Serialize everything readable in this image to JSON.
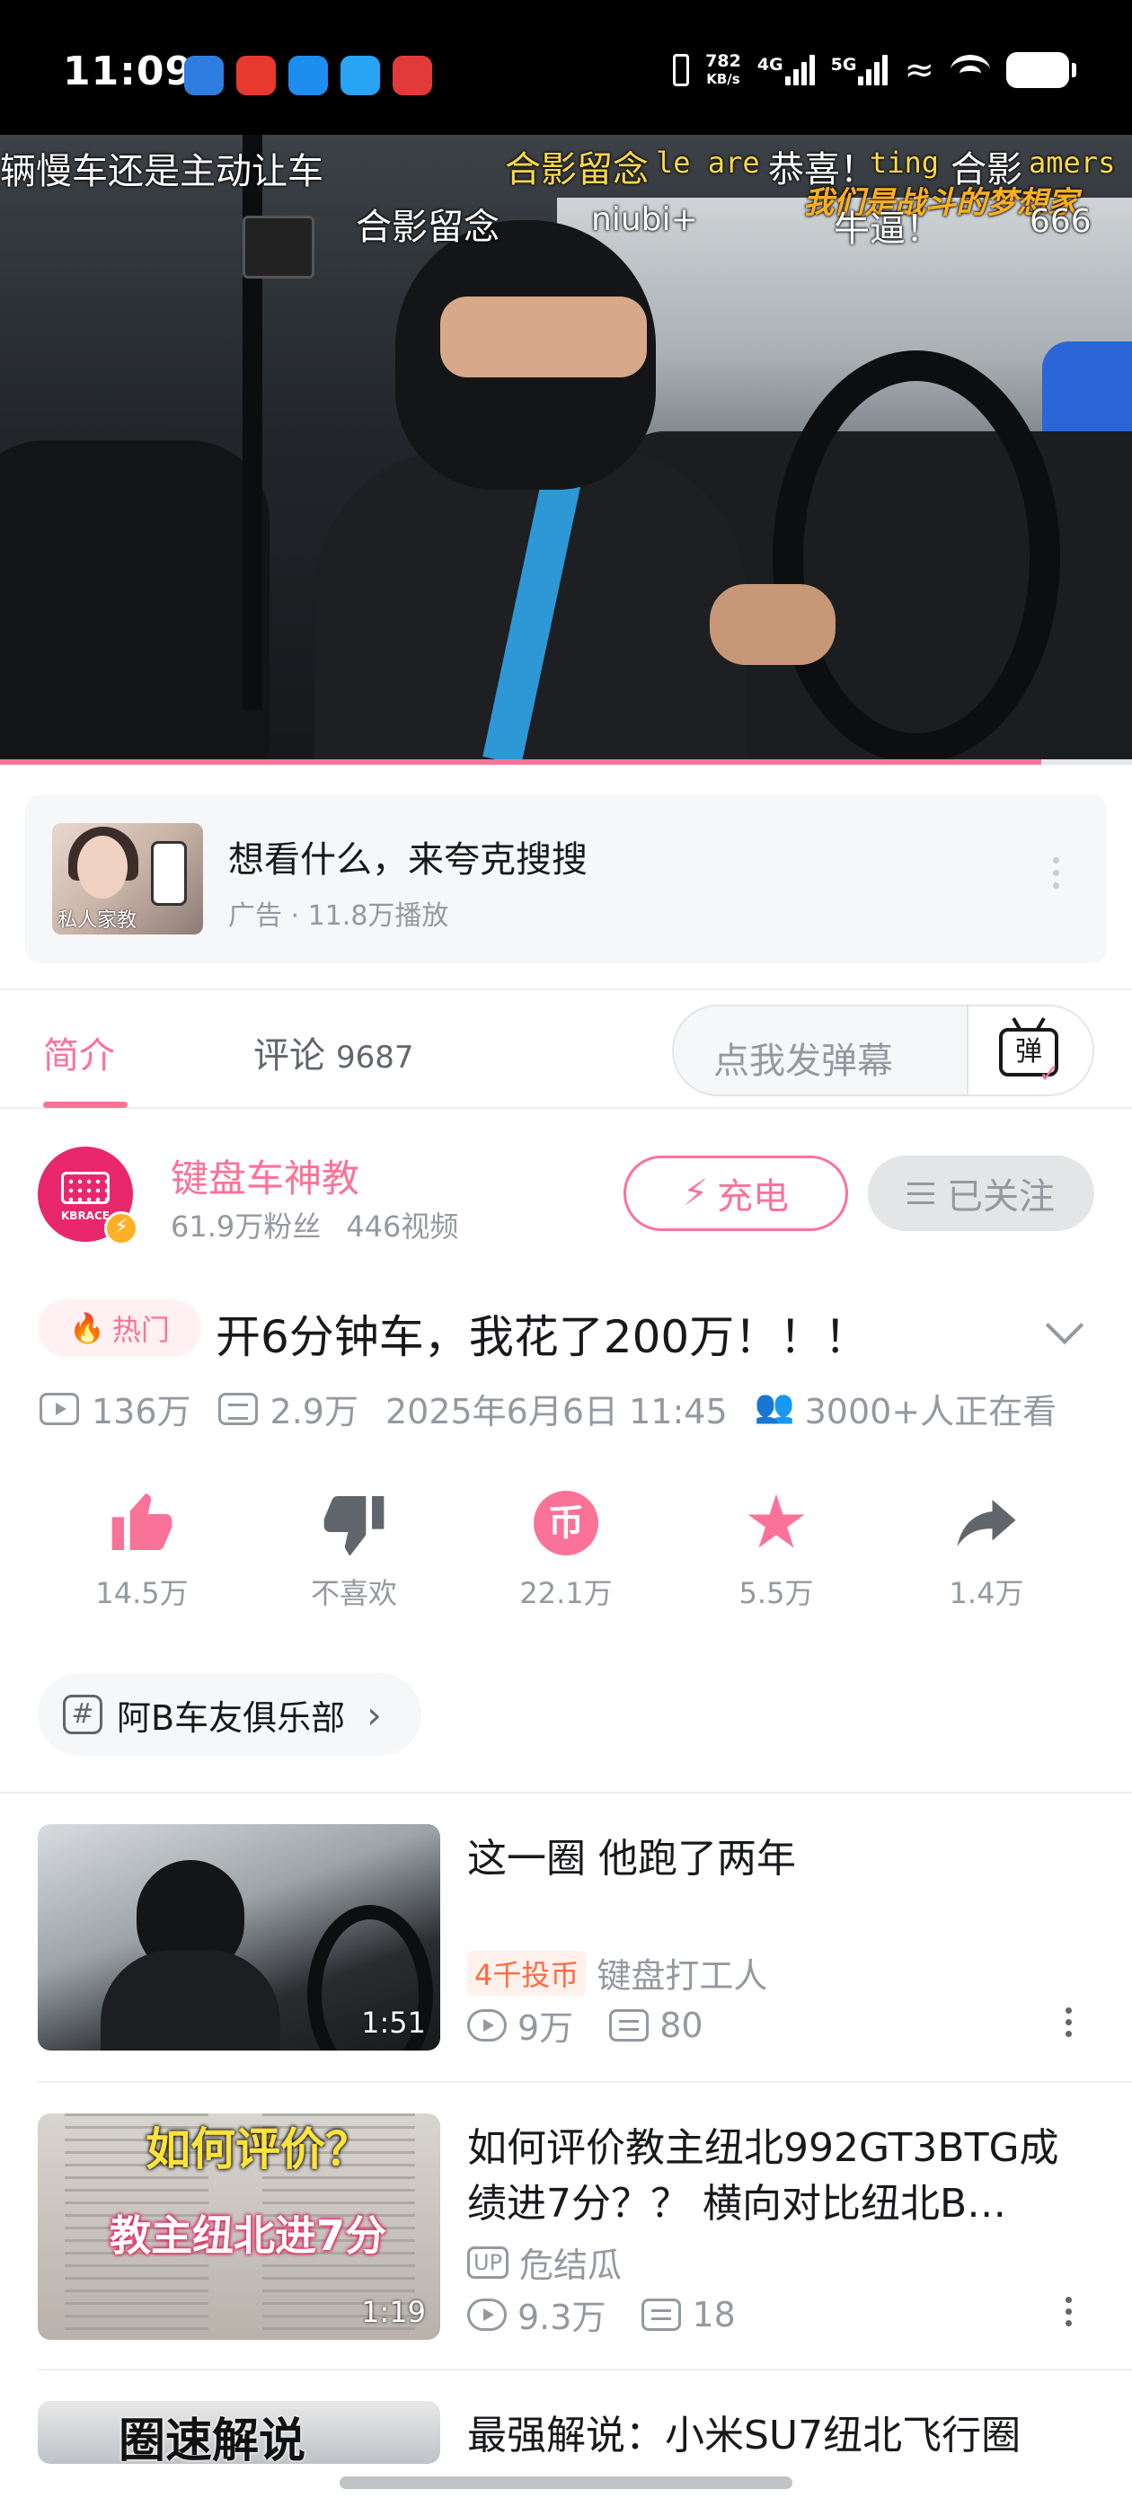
{
  "status_bar": {
    "time": "11:09",
    "net_speed_value": "782",
    "net_speed_unit": "KB/s",
    "net_4g": "4G",
    "net_5g": "5G"
  },
  "player": {
    "progress_fraction": 0.92,
    "danmaku": [
      {
        "text": "辆慢车还是主动让车",
        "color": "#ffffff"
      },
      {
        "text": "合影留念",
        "color": "#ffd84a"
      },
      {
        "text": "le are",
        "color": "#ffd84a"
      },
      {
        "text": "恭喜！",
        "color": "#ffffff"
      },
      {
        "text": "ting",
        "color": "#ffd84a"
      },
      {
        "text": "合影",
        "color": "#ffffff"
      },
      {
        "text": "amers",
        "color": "#ffd84a"
      },
      {
        "text": "合影留念",
        "color": "#ffffff"
      },
      {
        "text": "niubi+",
        "color": "#ffffff"
      },
      {
        "text": "我们是战斗的梦想家",
        "color": "#ffb01f"
      },
      {
        "text": "牛逼！",
        "color": "#ffffff"
      },
      {
        "text": "666",
        "color": "#ffffff"
      }
    ]
  },
  "ad": {
    "thumb_caption": "私人家教",
    "title": "想看什么，来夸克搜搜",
    "subtitle": "广告 · 11.8万播放"
  },
  "tabs": {
    "intro": "简介",
    "comments": "评论",
    "comments_count": "9687",
    "danmu_placeholder": "点我发弹幕",
    "danmu_button": "弹"
  },
  "uploader": {
    "avatar_text": "KBRACE",
    "name": "键盘车神教",
    "fans": "61.9万粉丝",
    "videos": "446视频",
    "charge_label": "充电",
    "follow_label": "已关注"
  },
  "video": {
    "hot_badge": "热门",
    "title": "开6分钟车，我花了200万！！！",
    "views": "136万",
    "danmaku_count": "2.9万",
    "publish_time": "2025年6月6日 11:45",
    "watching": "3000+人正在看"
  },
  "actions": [
    {
      "label": "14.5万",
      "icon": "like-icon"
    },
    {
      "label": "不喜欢",
      "icon": "dislike-icon"
    },
    {
      "label": "22.1万",
      "icon": "coin-icon"
    },
    {
      "label": "5.5万",
      "icon": "favorite-icon"
    },
    {
      "label": "1.4万",
      "icon": "share-icon"
    }
  ],
  "coin_glyph": "币",
  "club_tag": "阿B车友俱乐部",
  "related": [
    {
      "title": "这一圈 他跑了两年",
      "duration": "1:51",
      "badge": "4千投币",
      "uploader": "键盘打工人",
      "views": "9万",
      "danmaku": "80"
    },
    {
      "title": "如何评价教主纽北992GT3BTG成绩进7分？？ 横向对比纽北B…",
      "duration": "1:19",
      "badge": "UP",
      "uploader": "危结瓜",
      "views": "9.3万",
      "danmaku": "18",
      "thumb_text_top": "如何评价？",
      "thumb_text_mid": "教主纽北进7分"
    },
    {
      "title": "最强解说：小米SU7纽北飞行圈",
      "thumb_text_top": "圈速解说"
    }
  ]
}
